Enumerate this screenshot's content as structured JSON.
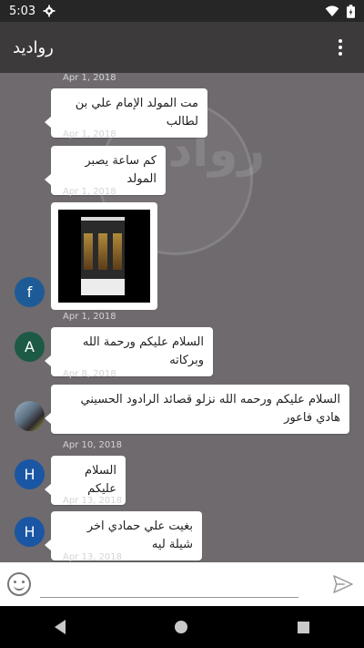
{
  "status_bar": {
    "time": "5:03"
  },
  "app_bar": {
    "title": "روادید"
  },
  "messages": [
    {
      "date": "Apr 1, 2018",
      "text": "مت المولد الإمام علي بن لطالب"
    },
    {
      "date": "Apr 1, 2018",
      "text": "كم ساعة  يصبر المولد"
    },
    {
      "date": "Apr 1, 2018",
      "sender": "f",
      "type": "image"
    },
    {
      "date": "Apr 1, 2018",
      "sender": "A",
      "text": "السلام عليكم ورحمة الله وبركاته"
    },
    {
      "date": "Apr 8, 2018",
      "sender": "photo",
      "text": "السلام عليكم ورحمه الله نزلو قصائد الرادود الحسيني هادي فاعور"
    },
    {
      "date": "Apr 10, 2018",
      "sender": "H",
      "text": "السلام عليكم"
    },
    {
      "date": "Apr 13, 2018",
      "sender": "H",
      "text": "بغيت علي حمادي اخر شيلة ليه"
    },
    {
      "date": "Apr 13, 2018"
    }
  ],
  "input": {
    "placeholder": ""
  },
  "colors": {
    "avatar_f": "#1d5b96",
    "avatar_a": "#1d5a46",
    "avatar_h": "#1a56a3"
  },
  "icons": [
    "gear-icon",
    "wifi-icon",
    "battery-icon",
    "more-vert-icon",
    "emoji-icon",
    "send-icon",
    "nav-back-icon",
    "nav-home-icon",
    "nav-recents-icon"
  ]
}
